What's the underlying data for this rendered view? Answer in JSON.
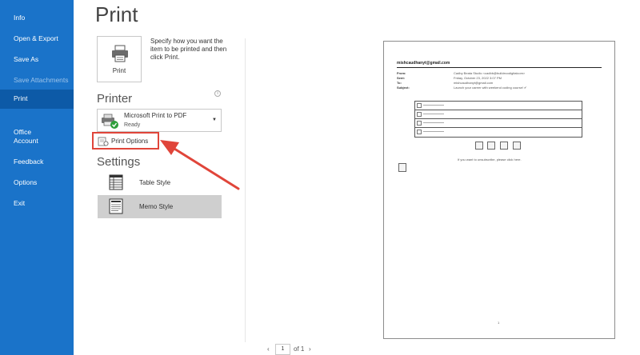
{
  "sidebar": {
    "items": [
      {
        "label": "Info"
      },
      {
        "label": "Open & Export"
      },
      {
        "label": "Save As"
      },
      {
        "label": "Save Attachments"
      },
      {
        "label": "Print"
      },
      {
        "label": "Office"
      },
      {
        "label": "Account"
      },
      {
        "label": "Feedback"
      },
      {
        "label": "Options"
      },
      {
        "label": "Exit"
      }
    ]
  },
  "page_title": "Print",
  "print_button": {
    "label": "Print",
    "icon": "printer-icon"
  },
  "print_description": "Specify how you want the item to be printed and then click Print.",
  "printer": {
    "heading": "Printer",
    "name": "Microsoft Print to PDF",
    "status": "Ready",
    "info_glyph": "i"
  },
  "print_options": {
    "label": "Print Options"
  },
  "settings": {
    "heading": "Settings",
    "styles": [
      {
        "label": "Table Style",
        "selected": false
      },
      {
        "label": "Memo Style",
        "selected": true
      }
    ]
  },
  "preview": {
    "email": "mishcaudhanyt@gmail.com",
    "fields": [
      {
        "label": "From:",
        "value": "Cadby Beata Studio <cadbb@buildecodigitalcom>"
      },
      {
        "label": "Sent:",
        "value": "Friday, October 23, 2022 3:07 PM"
      },
      {
        "label": "To:",
        "value": "mishcaudhanyt@gmail.com"
      },
      {
        "label": "Subject:",
        "value": "Launch your career with weekend coding course! ✔"
      }
    ],
    "unsubscribe": "If you want to unsubscribe, please click here.",
    "page_number": "1"
  },
  "pager": {
    "current": "1",
    "of_label": "of 1"
  },
  "colors": {
    "sidebar": "#1a73c9",
    "sidebar_active": "#0d5aa7",
    "highlight": "#e0453a"
  }
}
